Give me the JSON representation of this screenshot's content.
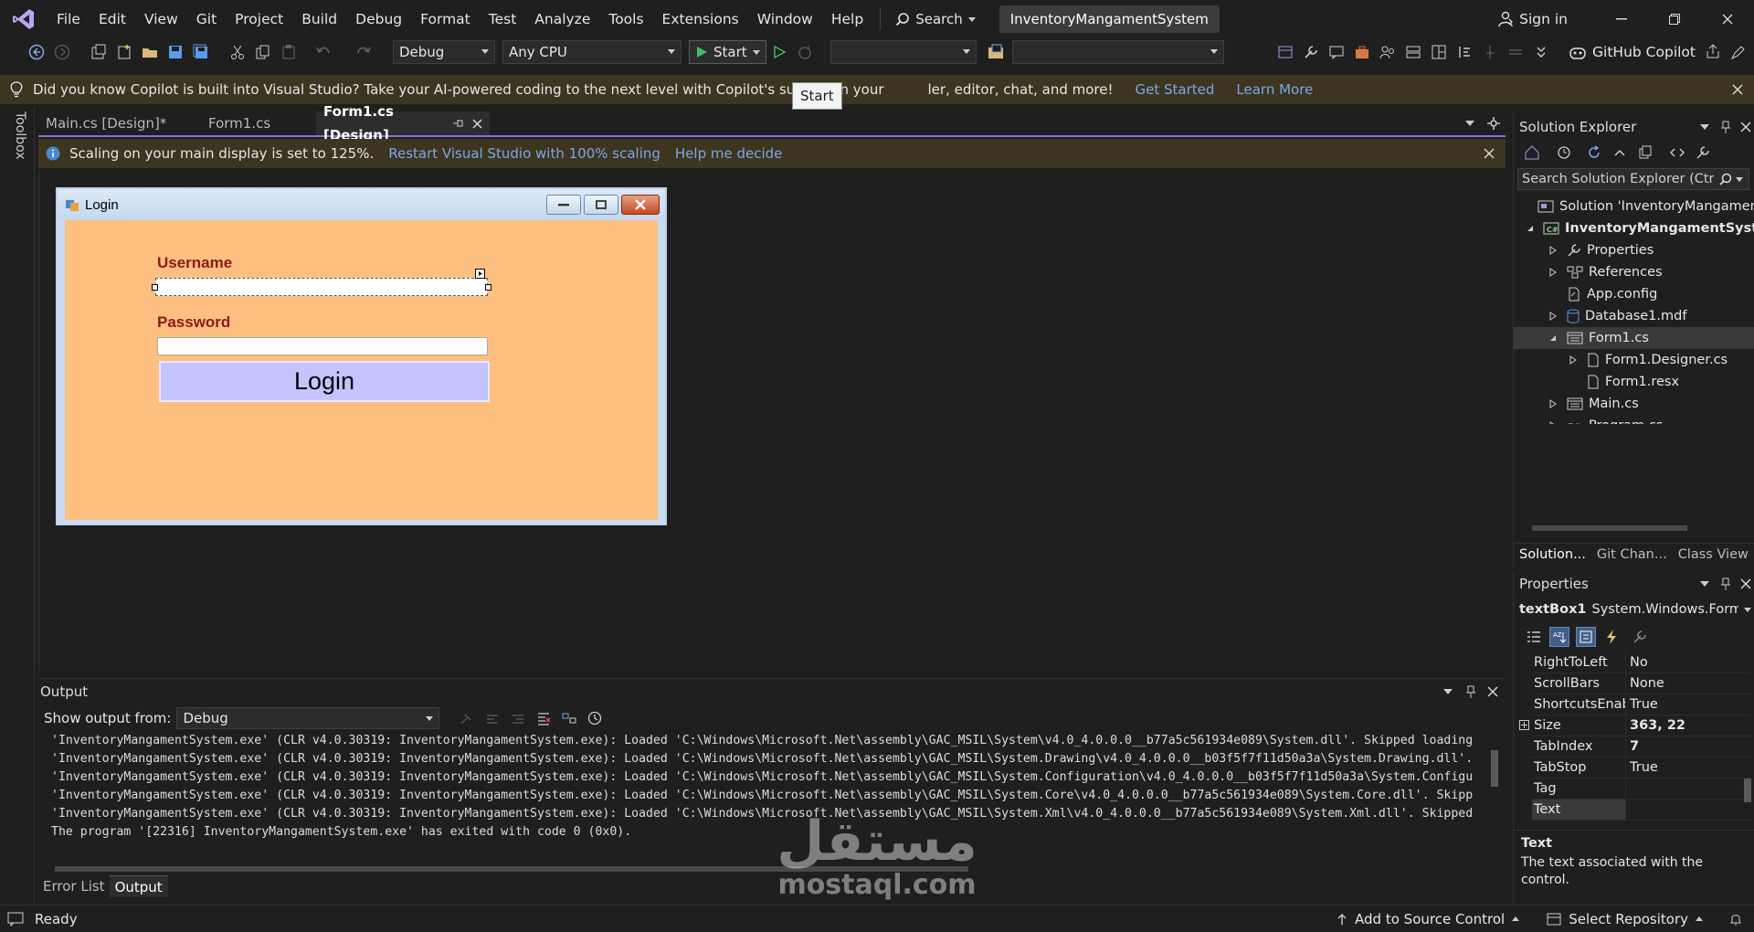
{
  "menu": [
    "File",
    "Edit",
    "View",
    "Git",
    "Project",
    "Build",
    "Debug",
    "Format",
    "Test",
    "Analyze",
    "Tools",
    "Extensions",
    "Window",
    "Help"
  ],
  "search_label": "Search",
  "solution_title": "InventoryMangamentSystem",
  "sign_in": "Sign in",
  "toolbar": {
    "config": "Debug",
    "platform": "Any CPU",
    "start": "Start",
    "copilot": "GitHub Copilot",
    "tooltip": "Start"
  },
  "copilot_bar": {
    "message_a": "Did you know Copilot is built into Visual Studio? Take your AI-powered coding to the next level with Copilot's support in your",
    "message_b": "ler, editor, chat, and more!",
    "get_started": "Get Started",
    "learn_more": "Learn More"
  },
  "tabs": [
    {
      "label": "Main.cs [Design]*"
    },
    {
      "label": "Form1.cs"
    },
    {
      "label": "Form1.cs [Design]"
    }
  ],
  "scale_bar": {
    "message": "Scaling on your main display is set to 125%.",
    "restart": "Restart Visual Studio with 100% scaling",
    "help": "Help me decide"
  },
  "form": {
    "title": "Login",
    "username_label": "Username",
    "password_label": "Password",
    "login_button": "Login"
  },
  "output": {
    "title": "Output",
    "show_from": "Show output from:",
    "source": "Debug",
    "lines": [
      "'InventoryMangamentSystem.exe' (CLR v4.0.30319: InventoryMangamentSystem.exe): Loaded 'C:\\Windows\\Microsoft.Net\\assembly\\GAC_MSIL\\System\\v4.0_4.0.0.0__b77a5c561934e089\\System.dll'. Skipped loading",
      "'InventoryMangamentSystem.exe' (CLR v4.0.30319: InventoryMangamentSystem.exe): Loaded 'C:\\Windows\\Microsoft.Net\\assembly\\GAC_MSIL\\System.Drawing\\v4.0_4.0.0.0__b03f5f7f11d50a3a\\System.Drawing.dll'.",
      "'InventoryMangamentSystem.exe' (CLR v4.0.30319: InventoryMangamentSystem.exe): Loaded 'C:\\Windows\\Microsoft.Net\\assembly\\GAC_MSIL\\System.Configuration\\v4.0_4.0.0.0__b03f5f7f11d50a3a\\System.Configu",
      "'InventoryMangamentSystem.exe' (CLR v4.0.30319: InventoryMangamentSystem.exe): Loaded 'C:\\Windows\\Microsoft.Net\\assembly\\GAC_MSIL\\System.Core\\v4.0_4.0.0.0__b77a5c561934e089\\System.Core.dll'. Skipp",
      "'InventoryMangamentSystem.exe' (CLR v4.0.30319: InventoryMangamentSystem.exe): Loaded 'C:\\Windows\\Microsoft.Net\\assembly\\GAC_MSIL\\System.Xml\\v4.0_4.0.0.0__b77a5c561934e089\\System.Xml.dll'. Skipped",
      "The program '[22316] InventoryMangamentSystem.exe' has exited with code 0 (0x0)."
    ]
  },
  "bottom_tabs": [
    "Error List",
    "Output"
  ],
  "status": {
    "ready": "Ready",
    "source_control": "Add to Source Control",
    "repository": "Select Repository"
  },
  "toolbox_label": "Toolbox",
  "solution_explorer": {
    "title": "Solution Explorer",
    "search_placeholder": "Search Solution Explorer (Ctrl+",
    "items": [
      {
        "label": "Solution 'InventoryMangamentS"
      },
      {
        "label": "InventoryMangamentSyste"
      },
      {
        "label": "Properties"
      },
      {
        "label": "References"
      },
      {
        "label": "App.config"
      },
      {
        "label": "Database1.mdf"
      },
      {
        "label": "Form1.cs"
      },
      {
        "label": "Form1.Designer.cs"
      },
      {
        "label": "Form1.resx"
      },
      {
        "label": "Main.cs"
      },
      {
        "label": "Program.cs"
      }
    ],
    "bottom_tabs": [
      "Solution...",
      "Git Chan...",
      "Class View"
    ]
  },
  "properties": {
    "title": "Properties",
    "object_name": "textBox1",
    "object_type": "System.Windows.Forms",
    "rows": [
      {
        "name": "RightToLeft",
        "value": "No"
      },
      {
        "name": "ScrollBars",
        "value": "None"
      },
      {
        "name": "ShortcutsEnabl",
        "value": "True"
      },
      {
        "name": "Size",
        "value": "363, 22"
      },
      {
        "name": "TabIndex",
        "value": "7"
      },
      {
        "name": "TabStop",
        "value": "True"
      },
      {
        "name": "Tag",
        "value": ""
      },
      {
        "name": "Text",
        "value": ""
      }
    ],
    "desc_title": "Text",
    "desc_body": "The text associated with the control."
  },
  "watermark": {
    "arabic": "مستقل",
    "latin": "mostaql.com"
  },
  "colors": {
    "accent": "#8b6fd6",
    "infobar": "#3d3520",
    "form_client": "#ffbf80",
    "label_red": "#8b1a1a",
    "button_lavender": "#c4c4ff"
  }
}
